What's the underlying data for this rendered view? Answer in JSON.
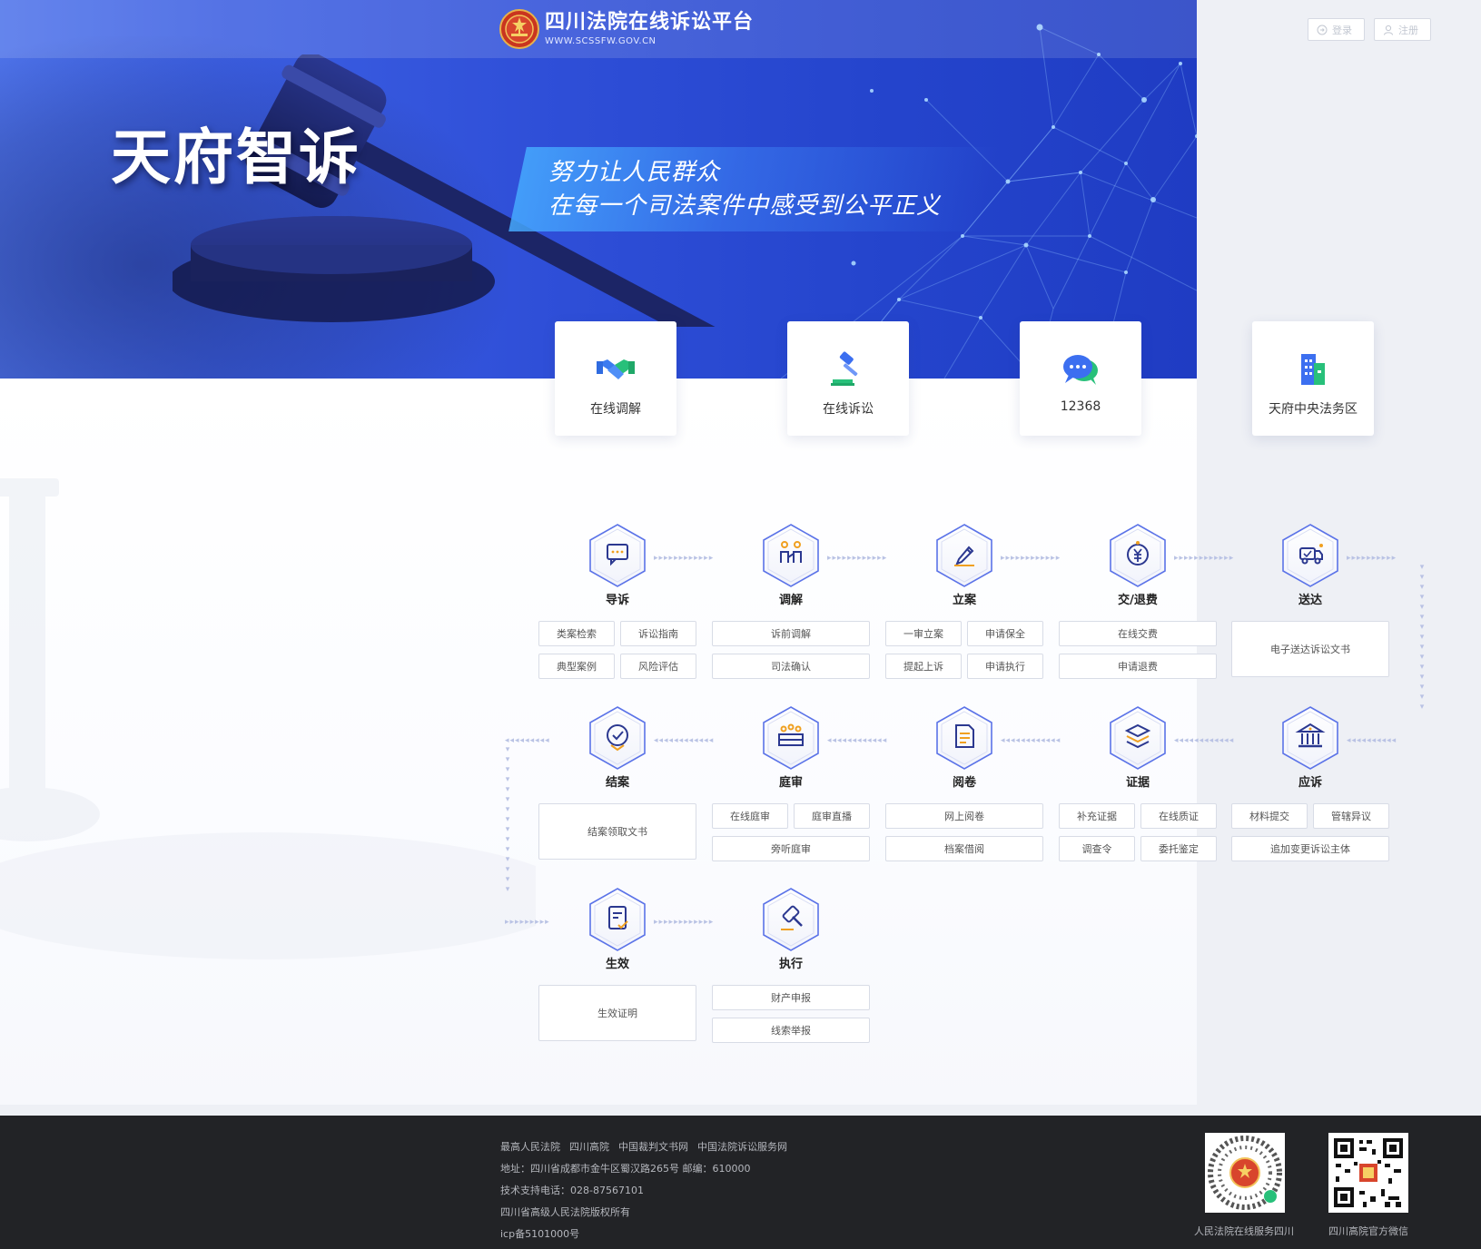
{
  "header": {
    "site_title": "四川法院在线诉讼平台",
    "site_url": "WWW.SCSSFW.GOV.CN",
    "login_label": "登录",
    "register_label": "注册"
  },
  "hero": {
    "title": "天府智诉",
    "slogan_line1": "努力让人民群众",
    "slogan_line2": "在每一个司法案件中感受到公平正义"
  },
  "cards": [
    {
      "label": "在线调解",
      "icon": "handshake-icon"
    },
    {
      "label": "在线诉讼",
      "icon": "gavel-icon"
    },
    {
      "label": "12368",
      "icon": "chat-bubbles-icon"
    },
    {
      "label": "天府中央法务区",
      "icon": "building-icon"
    }
  ],
  "flow": {
    "steps": [
      {
        "label": "导诉",
        "icon": "guide-chat-icon",
        "chips": [
          "类案检索",
          "诉讼指南",
          "典型案例",
          "风险评估"
        ]
      },
      {
        "label": "调解",
        "icon": "mediation-icon",
        "chips": [
          "诉前调解",
          "司法确认"
        ]
      },
      {
        "label": "立案",
        "icon": "pen-icon",
        "chips": [
          "一审立案",
          "申请保全",
          "提起上诉",
          "申请执行"
        ]
      },
      {
        "label": "交/退费",
        "icon": "yuan-icon",
        "chips": [
          "在线交费",
          "申请退费"
        ]
      },
      {
        "label": "送达",
        "icon": "delivery-truck-icon",
        "chips": [
          "电子送达诉讼文书"
        ]
      },
      {
        "label": "结案",
        "icon": "check-pin-icon",
        "chips": [
          "结案领取文书"
        ]
      },
      {
        "label": "庭审",
        "icon": "courtroom-icon",
        "chips": [
          "在线庭审",
          "庭审直播",
          "旁听庭审"
        ]
      },
      {
        "label": "阅卷",
        "icon": "document-icon",
        "chips": [
          "网上阅卷",
          "档案借阅"
        ]
      },
      {
        "label": "证据",
        "icon": "layers-icon",
        "chips": [
          "补充证据",
          "在线质证",
          "调查令",
          "委托鉴定"
        ]
      },
      {
        "label": "应诉",
        "icon": "court-building-icon",
        "chips": [
          "材料提交",
          "管辖异议",
          "追加变更诉讼主体"
        ]
      },
      {
        "label": "生效",
        "icon": "certificate-icon",
        "chips": [
          "生效证明"
        ]
      },
      {
        "label": "执行",
        "icon": "execution-gavel-icon",
        "chips": [
          "财产申报",
          "线索举报"
        ]
      }
    ]
  },
  "footer": {
    "links": [
      "最高人民法院",
      "四川高院",
      "中国裁判文书网",
      "中国法院诉讼服务网"
    ],
    "address": "地址：四川省成都市金牛区蜀汉路265号    邮编：610000",
    "support": "技术支持电话：028-87567101",
    "copyright": "四川省高级人民法院版权所有",
    "icp": "icp备5101000号",
    "qr1_label": "人民法院在线服务四川",
    "qr2_label": "四川高院官方微信"
  },
  "colors": {
    "hero_blue": "#2f4fd8",
    "accent": "#3d5fe0",
    "footer_bg": "#222326"
  }
}
